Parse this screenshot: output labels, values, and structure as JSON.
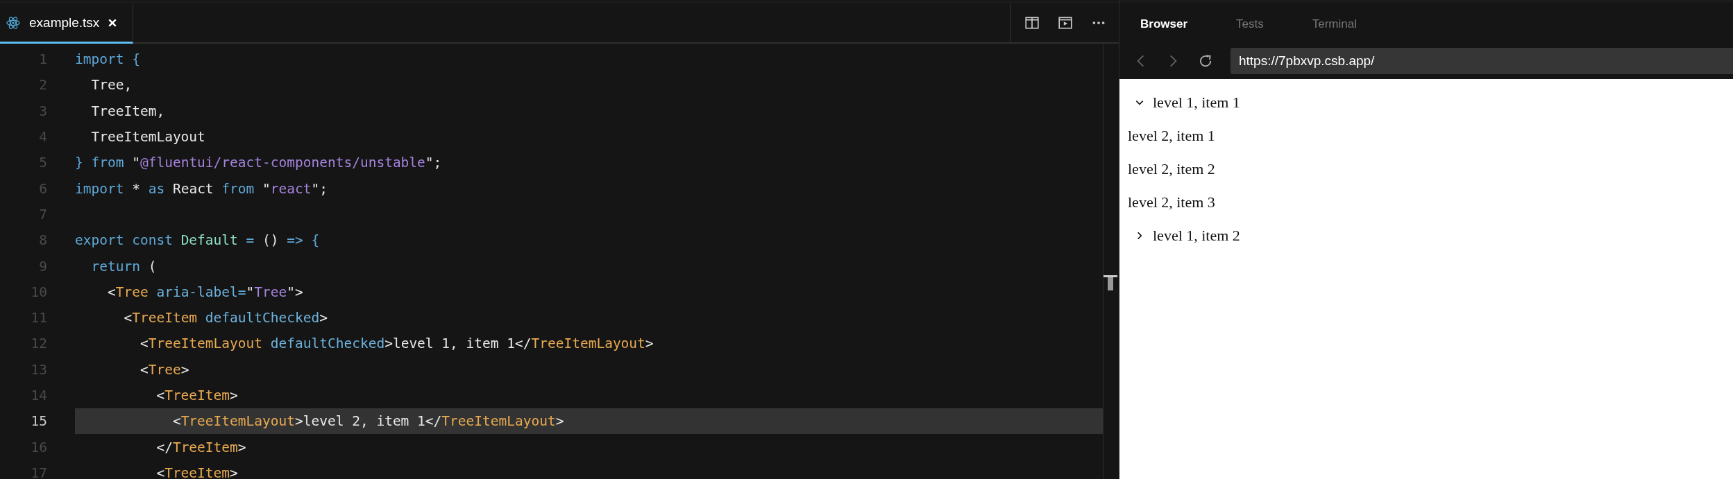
{
  "editor": {
    "tab": {
      "label": "example.tsx",
      "selected": true
    },
    "lines": [
      {
        "number": "1",
        "current": false,
        "tokens": [
          {
            "kind": "keyword",
            "text": "import {"
          }
        ]
      },
      {
        "number": "2",
        "current": false,
        "tokens": [
          {
            "kind": "plain",
            "text": "  Tree,"
          }
        ]
      },
      {
        "number": "3",
        "current": false,
        "tokens": [
          {
            "kind": "plain",
            "text": "  TreeItem,"
          }
        ]
      },
      {
        "number": "4",
        "current": false,
        "tokens": [
          {
            "kind": "plain",
            "text": "  TreeItemLayout"
          }
        ]
      },
      {
        "number": "5",
        "current": false,
        "tokens": [
          {
            "kind": "keyword",
            "text": "} from"
          },
          {
            "kind": "plain",
            "text": " \""
          },
          {
            "kind": "string",
            "text": "@fluentui/react-components/unstable"
          },
          {
            "kind": "plain",
            "text": "\";"
          }
        ]
      },
      {
        "number": "6",
        "current": false,
        "tokens": [
          {
            "kind": "keyword",
            "text": "import"
          },
          {
            "kind": "plain",
            "text": " * "
          },
          {
            "kind": "keyword",
            "text": "as"
          },
          {
            "kind": "plain",
            "text": " React "
          },
          {
            "kind": "keyword",
            "text": "from"
          },
          {
            "kind": "plain",
            "text": " \""
          },
          {
            "kind": "string",
            "text": "react"
          },
          {
            "kind": "plain",
            "text": "\";"
          }
        ]
      },
      {
        "number": "7",
        "current": false
      },
      {
        "number": "8",
        "current": false,
        "tokens": [
          {
            "kind": "keyword",
            "text": "export const "
          },
          {
            "kind": "name",
            "text": "Default "
          },
          {
            "kind": "keyword",
            "text": "= "
          },
          {
            "kind": "plain",
            "text": "() "
          },
          {
            "kind": "keyword",
            "text": "=> {"
          }
        ]
      },
      {
        "number": "9",
        "current": false,
        "tokens": [
          {
            "kind": "keyword",
            "text": "  return"
          },
          {
            "kind": "plain",
            "text": " ("
          }
        ]
      },
      {
        "number": "10",
        "current": false,
        "tokens": [
          {
            "kind": "plain",
            "text": "    <"
          },
          {
            "kind": "tag",
            "text": "Tree "
          },
          {
            "kind": "attr",
            "text": "aria-label"
          },
          {
            "kind": "keyword",
            "text": "="
          },
          {
            "kind": "plain",
            "text": "\""
          },
          {
            "kind": "string",
            "text": "Tree"
          },
          {
            "kind": "plain",
            "text": "\">"
          }
        ]
      },
      {
        "number": "11",
        "current": false,
        "tokens": [
          {
            "kind": "plain",
            "text": "      <"
          },
          {
            "kind": "tag",
            "text": "TreeItem "
          },
          {
            "kind": "attr",
            "text": "defaultChecked"
          },
          {
            "kind": "plain",
            "text": ">"
          }
        ]
      },
      {
        "number": "12",
        "current": false,
        "tokens": [
          {
            "kind": "plain",
            "text": "        <"
          },
          {
            "kind": "tag",
            "text": "TreeItemLayout "
          },
          {
            "kind": "attr",
            "text": "defaultChecked"
          },
          {
            "kind": "plain",
            "text": ">level 1, item 1</"
          },
          {
            "kind": "tag",
            "text": "TreeItemLayout"
          },
          {
            "kind": "plain",
            "text": ">"
          }
        ]
      },
      {
        "number": "13",
        "current": false,
        "tokens": [
          {
            "kind": "plain",
            "text": "        <"
          },
          {
            "kind": "tag",
            "text": "Tree"
          },
          {
            "kind": "plain",
            "text": ">"
          }
        ]
      },
      {
        "number": "14",
        "current": false,
        "tokens": [
          {
            "kind": "plain",
            "text": "          <"
          },
          {
            "kind": "tag",
            "text": "TreeItem"
          },
          {
            "kind": "plain",
            "text": ">"
          }
        ]
      },
      {
        "number": "15",
        "current": true,
        "tokens": [
          {
            "kind": "plain",
            "text": "            <"
          },
          {
            "kind": "tag",
            "text": "TreeItemLayout"
          },
          {
            "kind": "plain",
            "text": ">level 2, item 1</"
          },
          {
            "kind": "tag",
            "text": "TreeItemLayout"
          },
          {
            "kind": "plain",
            "text": ">"
          }
        ]
      },
      {
        "number": "16",
        "current": false,
        "tokens": [
          {
            "kind": "plain",
            "text": "          </"
          },
          {
            "kind": "tag",
            "text": "TreeItem"
          },
          {
            "kind": "plain",
            "text": ">"
          }
        ]
      },
      {
        "number": "17",
        "current": false,
        "tokens": [
          {
            "kind": "plain",
            "text": "          <"
          },
          {
            "kind": "tag",
            "text": "TreeItem"
          },
          {
            "kind": "plain",
            "text": ">"
          }
        ]
      }
    ]
  },
  "preview": {
    "tabs": [
      {
        "label": "Browser",
        "selected": true
      },
      {
        "label": "Tests",
        "selected": false
      },
      {
        "label": "Terminal",
        "selected": false
      }
    ],
    "url": "https://7pbxvp.csb.app/",
    "tree": [
      {
        "label": "level 1, item 1",
        "expanded": true,
        "children": [
          {
            "label": "level 2, item 1"
          },
          {
            "label": "level 2, item 2"
          },
          {
            "label": "level 2, item 3"
          }
        ]
      },
      {
        "label": "level 1, item 2",
        "expanded": false
      }
    ]
  }
}
